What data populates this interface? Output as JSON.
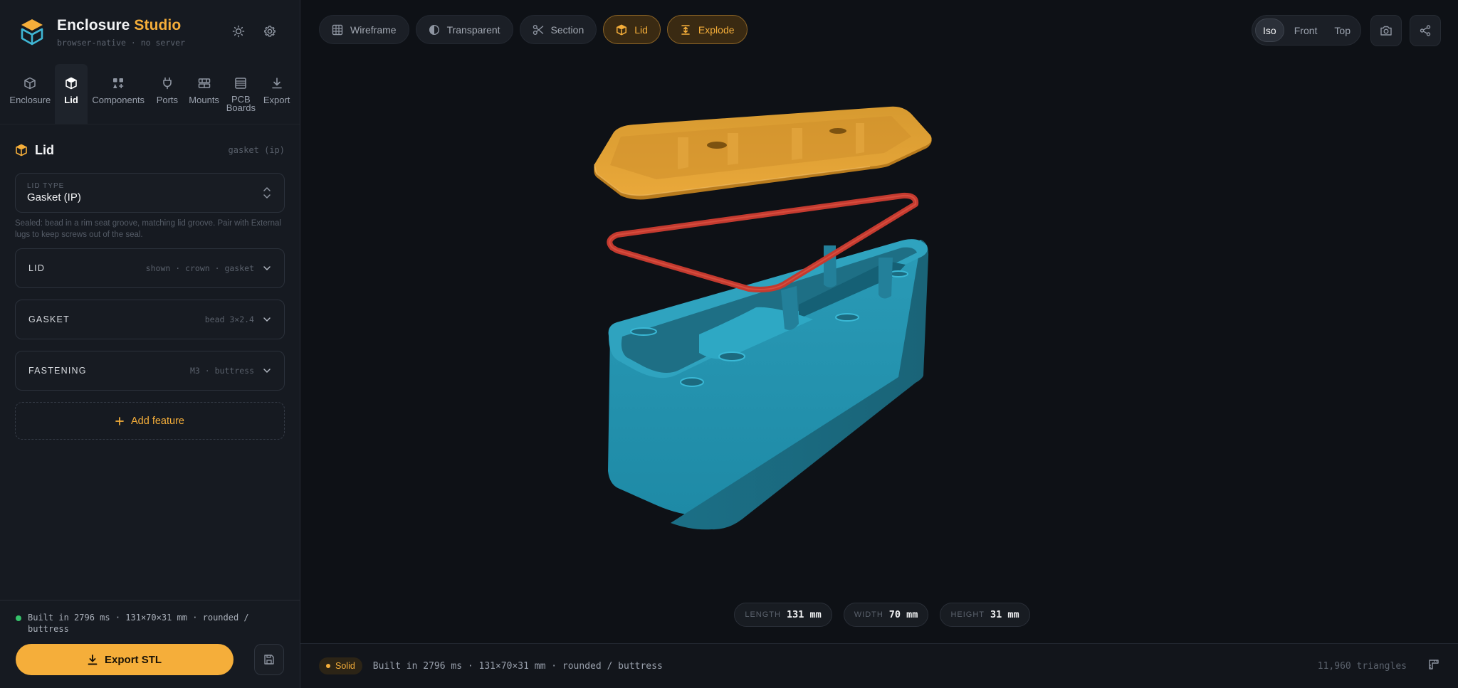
{
  "brand": {
    "title_main": "Enclosure",
    "title_accent": "Studio",
    "subtitle": "browser-native · no server"
  },
  "header_icons": [
    "sun-icon",
    "gear-icon"
  ],
  "nav": [
    {
      "label": "Enclosure",
      "icon": "box-icon"
    },
    {
      "label": "Lid",
      "icon": "lid-box-icon",
      "active": true
    },
    {
      "label": "Components",
      "icon": "components-icon"
    },
    {
      "label": "Ports",
      "icon": "plug-icon"
    },
    {
      "label": "Mounts",
      "icon": "mounts-icon"
    },
    {
      "label": "PCB Boards",
      "icon": "pcb-icon"
    },
    {
      "label": "Export",
      "icon": "download-icon"
    }
  ],
  "panel": {
    "title": "Lid",
    "tag": "gasket (ip)",
    "lid_type": {
      "caption": "LID TYPE",
      "value": "Gasket (IP)"
    },
    "hint": "Sealed: bead in a rim seat groove, matching lid groove. Pair with External lugs to keep screws out of the seal.",
    "sections": [
      {
        "name": "LID",
        "meta": "shown · crown · gasket"
      },
      {
        "name": "GASKET",
        "meta": "bead 3×2.4"
      },
      {
        "name": "FASTENING",
        "meta": "M3 · buttress"
      }
    ],
    "add_label": "Add feature"
  },
  "footer": {
    "status": "Built in 2796 ms · 131×70×31 mm · rounded / buttress",
    "export_label": "Export STL"
  },
  "toolbar": [
    {
      "label": "Wireframe",
      "icon": "grid-icon",
      "on": false
    },
    {
      "label": "Transparent",
      "icon": "half-circle-icon",
      "on": false
    },
    {
      "label": "Section",
      "icon": "scissors-icon",
      "on": false
    },
    {
      "label": "Lid",
      "icon": "lid-box-icon",
      "on": true
    },
    {
      "label": "Explode",
      "icon": "explode-icon",
      "on": true
    }
  ],
  "views": [
    {
      "label": "Iso",
      "on": true
    },
    {
      "label": "Front",
      "on": false
    },
    {
      "label": "Top",
      "on": false
    }
  ],
  "dims": [
    {
      "key": "LENGTH",
      "value": "131 mm"
    },
    {
      "key": "WIDTH",
      "value": "70 mm"
    },
    {
      "key": "HEIGHT",
      "value": "31 mm"
    }
  ],
  "bottom": {
    "mode": "Solid",
    "message": "Built in 2796 ms · 131×70×31 mm · rounded / buttress",
    "triangles": "11,960 triangles"
  },
  "colors": {
    "accent": "#f5ae3a",
    "base": "#2fa3bf",
    "lid": "#e6a332",
    "gasket": "#c43a2f"
  }
}
